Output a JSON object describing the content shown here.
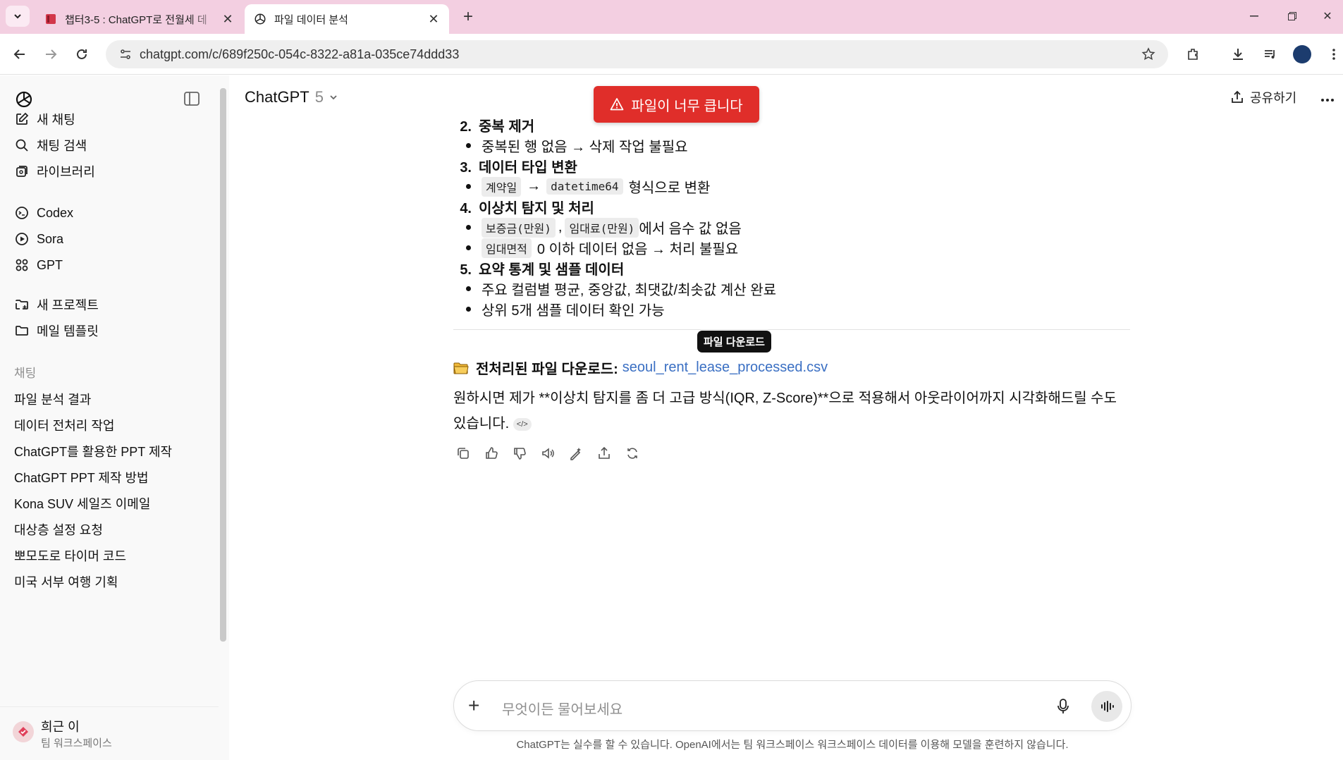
{
  "browser": {
    "tabs": [
      {
        "title": "챕터3-5 : ChatGPT로 전월세 데",
        "active": false
      },
      {
        "title": "파일 데이터 분석",
        "active": true
      }
    ],
    "url": "chatgpt.com/c/689f250c-054c-8322-a81a-035ce74ddd33"
  },
  "sidebar": {
    "nav": [
      {
        "label": "새 채팅",
        "icon": "edit-icon"
      },
      {
        "label": "채팅 검색",
        "icon": "search-icon"
      },
      {
        "label": "라이브러리",
        "icon": "library-icon"
      }
    ],
    "apps": [
      {
        "label": "Codex",
        "icon": "codex-icon"
      },
      {
        "label": "Sora",
        "icon": "sora-icon"
      },
      {
        "label": "GPT",
        "icon": "gpt-grid-icon"
      }
    ],
    "projects": [
      {
        "label": "새 프로젝트",
        "icon": "new-folder-icon"
      },
      {
        "label": "메일 템플릿",
        "icon": "folder-icon"
      }
    ],
    "chats_heading": "채팅",
    "chats": [
      "파일 분석 결과",
      "데이터 전처리 작업",
      "ChatGPT를 활용한 PPT 제작",
      "ChatGPT PPT 제작 방법",
      "Kona SUV 세일즈 이메일",
      "대상층 설정 요청",
      "뽀모도로 타이머 코드",
      "미국 서부 여행 기획"
    ],
    "user": {
      "name": "희근 이",
      "workspace": "팀 워크스페이스"
    }
  },
  "header": {
    "model": "ChatGPT",
    "version": "5",
    "share_label": "공유하기"
  },
  "toast": {
    "text": "파일이 너무 큽니다",
    "color": "#e02e2a"
  },
  "message": {
    "steps": [
      {
        "num": "2.",
        "title": "중복 제거"
      },
      {
        "num": "3.",
        "title": "데이터 타입 변환"
      },
      {
        "num": "4.",
        "title": "이상치 탐지 및 처리"
      },
      {
        "num": "5.",
        "title": "요약 통계 및 샘플 데이터"
      }
    ],
    "bullet_dup": "중복된 행 없음 → 삭제 작업 불필요",
    "code_contract_date": "계약일",
    "arrow": "→",
    "code_datetime": "datetime64",
    "bullet_type_suffix": "형식으로 변환",
    "code_deposit": "보증금(만원)",
    "comma": ",",
    "code_rent": "임대료(만원)",
    "bullet_neg_suffix": "에서 음수 값 없음",
    "code_area": "임대면적",
    "bullet_area_suffix": "0 이하 데이터 없음 → 처리 불필요",
    "bullet_summary": "주요 컬럼별 평균, 중앙값, 최댓값/최솟값 계산 완료",
    "bullet_sample": "상위 5개 샘플 데이터 확인 가능",
    "tooltip": "파일 다운로드",
    "download_label": "전처리된 파일 다운로드:",
    "download_link": "seoul_rent_lease_processed.csv",
    "paragraph": "원하시면 제가 **이상치 탐지를 좀 더 고급 방식(IQR, Z-Score)**으로 적용해서 아웃라이어까지 시각화해드릴 수도 있습니다.",
    "code_pill": "</>"
  },
  "composer": {
    "placeholder": "무엇이든 물어보세요"
  },
  "disclaimer": "ChatGPT는 실수를 할 수 있습니다. OpenAI에서는 팀 워크스페이스 워크스페이스 데이터를 이용해 모델을 훈련하지 않습니다."
}
